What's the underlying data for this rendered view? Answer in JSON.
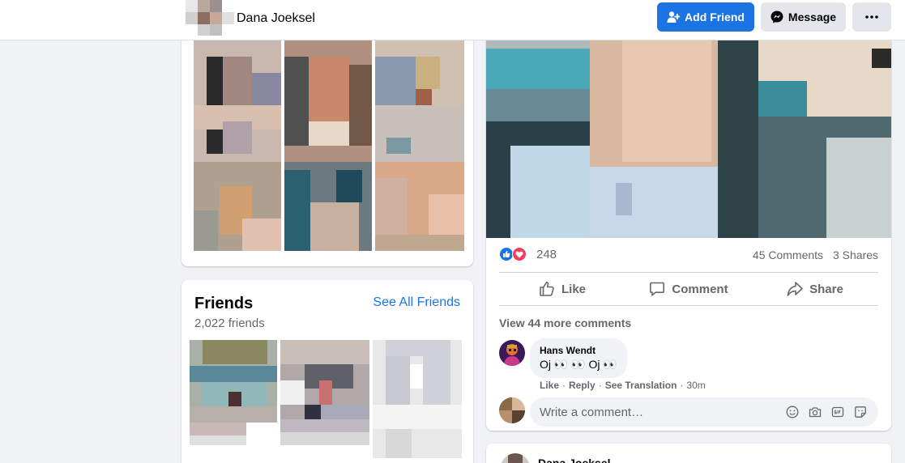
{
  "header": {
    "profile_name": "Dana Joeksel",
    "add_friend_label": "Add Friend",
    "message_label": "Message"
  },
  "friends": {
    "title": "Friends",
    "count": "2,022 friends",
    "see_all": "See All Friends"
  },
  "post": {
    "reaction_count": "248",
    "comments": "45 Comments",
    "shares": "3 Shares",
    "actions": {
      "like": "Like",
      "comment": "Comment",
      "share": "Share"
    },
    "view_more": "View 44 more comments",
    "comment": {
      "author": "Hans Wendt",
      "text": "Oj 👀 👀 Oj 👀",
      "like": "Like",
      "reply": "Reply",
      "see_translation": "See Translation",
      "time": "30m"
    },
    "write_placeholder": "Write a comment…"
  },
  "next_post": {
    "author": "Dana Joeksel"
  },
  "colors": {
    "accent": "#1b74e4",
    "love": "#f33e58",
    "background": "#f0f2f5",
    "secondary_text": "#65676b"
  },
  "icons": [
    "add-friend-icon",
    "messenger-icon",
    "more-icon",
    "like-icon",
    "comment-icon",
    "share-icon",
    "emoji-icon",
    "camera-icon",
    "gif-icon",
    "sticker-icon"
  ]
}
